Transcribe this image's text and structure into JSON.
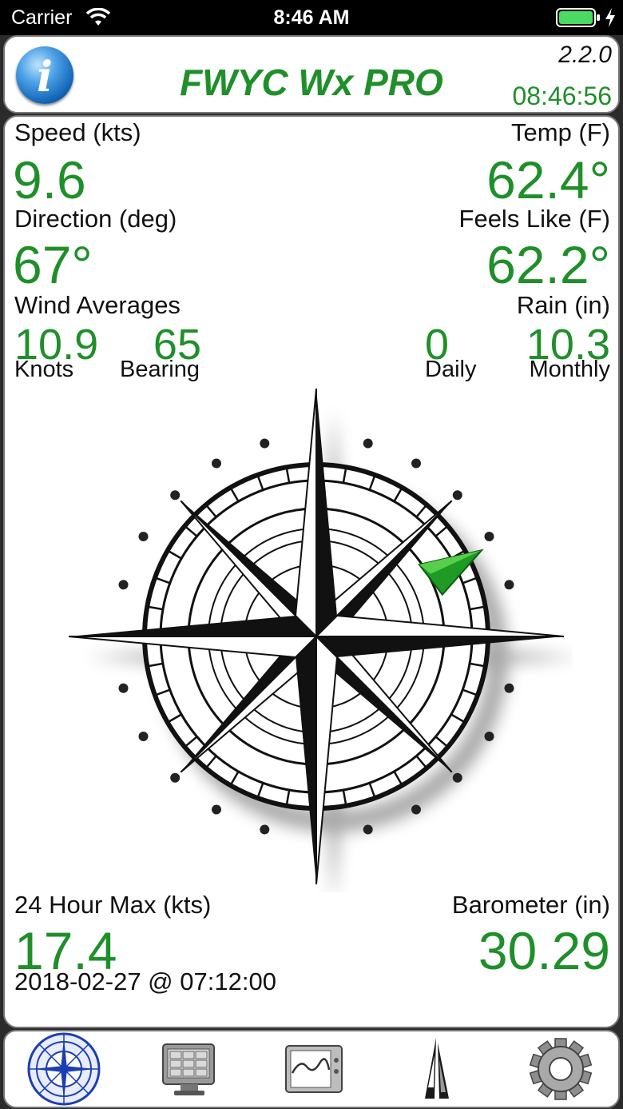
{
  "status_bar": {
    "carrier": "Carrier",
    "time": "8:46 AM"
  },
  "header": {
    "title": "FWYC Wx PRO",
    "version": "2.2.0",
    "clock": "08:46:56"
  },
  "wind": {
    "speed_label": "Speed (kts)",
    "speed_value": "9.6",
    "direction_label": "Direction (deg)",
    "direction_value": "67°",
    "averages_label": "Wind Averages",
    "avg_knots_value": "10.9",
    "avg_knots_label": "Knots",
    "avg_bearing_value": "65",
    "avg_bearing_label": "Bearing"
  },
  "weather": {
    "temp_label": "Temp (F)",
    "temp_value": "62.4°",
    "feels_label": "Feels Like (F)",
    "feels_value": "62.2°",
    "rain_label": "Rain (in)",
    "rain_daily_value": "0",
    "rain_daily_label": "Daily",
    "rain_monthly_value": "10.3",
    "rain_monthly_label": "Monthly"
  },
  "max": {
    "label": "24 Hour Max (kts)",
    "value": "17.4",
    "timestamp": "2018-02-27 @ 07:12:00"
  },
  "barometer": {
    "label": "Barometer (in)",
    "value": "30.29"
  },
  "tabs": [
    {
      "icon": "compass-rose-icon"
    },
    {
      "icon": "monitor-display-icon"
    },
    {
      "icon": "graph-monitor-icon"
    },
    {
      "icon": "sailboat-icon"
    },
    {
      "icon": "gear-icon"
    }
  ],
  "colors": {
    "value_green": "#1f8f2a",
    "accent_blue": "#1b5fb8"
  }
}
